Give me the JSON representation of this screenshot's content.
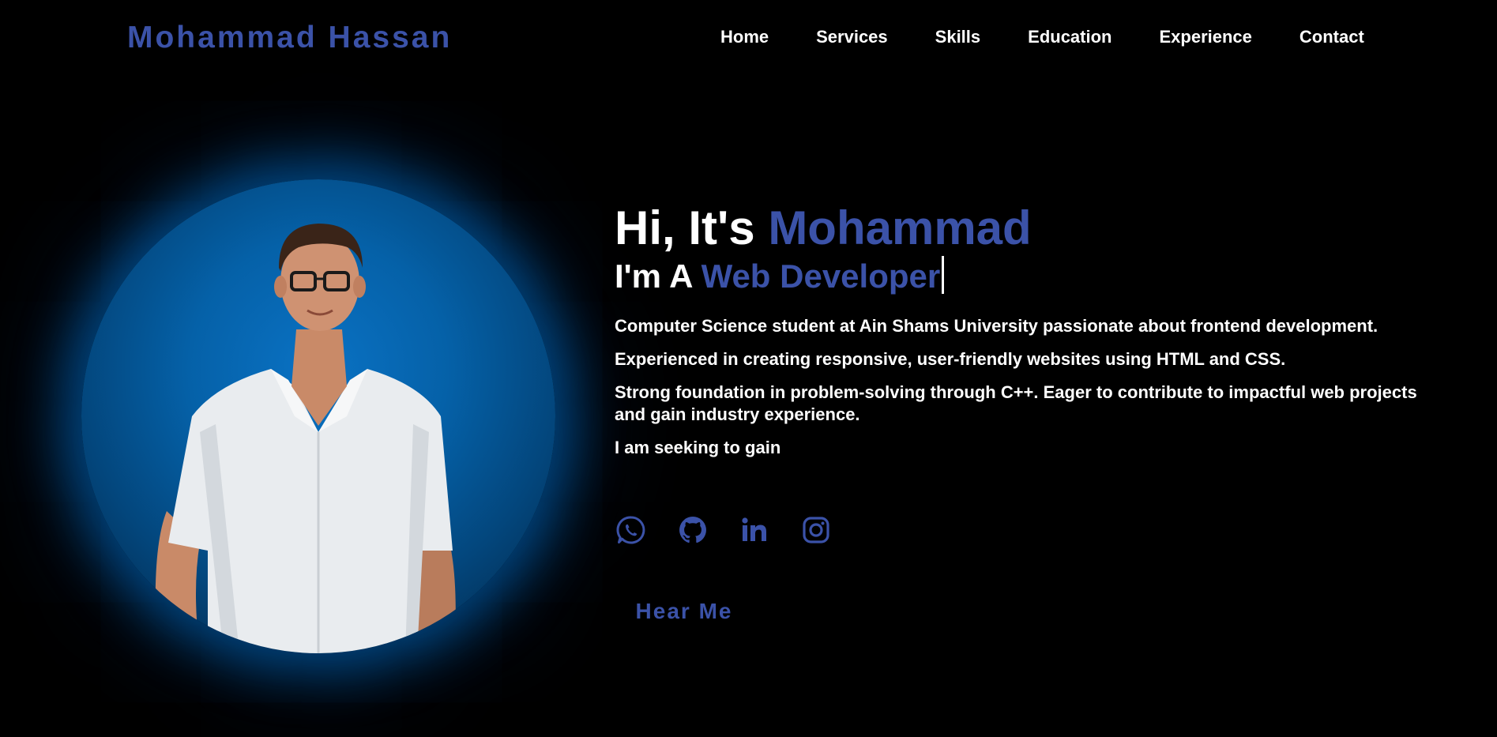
{
  "brand": {
    "name": "Mohammad Hassan"
  },
  "nav": {
    "items": [
      {
        "label": "Home"
      },
      {
        "label": "Services"
      },
      {
        "label": "Skills"
      },
      {
        "label": "Education"
      },
      {
        "label": "Experience"
      },
      {
        "label": "Contact"
      }
    ]
  },
  "hero": {
    "greeting": "Hi, It's",
    "name": "Mohammad",
    "role_prefix": "I'm A",
    "role": "Web Developer",
    "paragraphs": [
      "Computer Science student at Ain Shams University passionate about frontend development.",
      "Experienced in creating responsive, user-friendly websites using HTML and CSS.",
      "Strong foundation in problem-solving through C++. Eager to contribute to impactful web projects and gain industry experience.",
      "I am seeking to gain"
    ],
    "cta_label": "Hear Me"
  },
  "socials": [
    {
      "icon": "whatsapp-icon"
    },
    {
      "icon": "github-icon"
    },
    {
      "icon": "linkedin-icon"
    },
    {
      "icon": "instagram-icon"
    }
  ],
  "colors": {
    "accent": "#3b52a8",
    "background": "#000000",
    "text": "#ffffff",
    "glow": "#0a72c4"
  }
}
